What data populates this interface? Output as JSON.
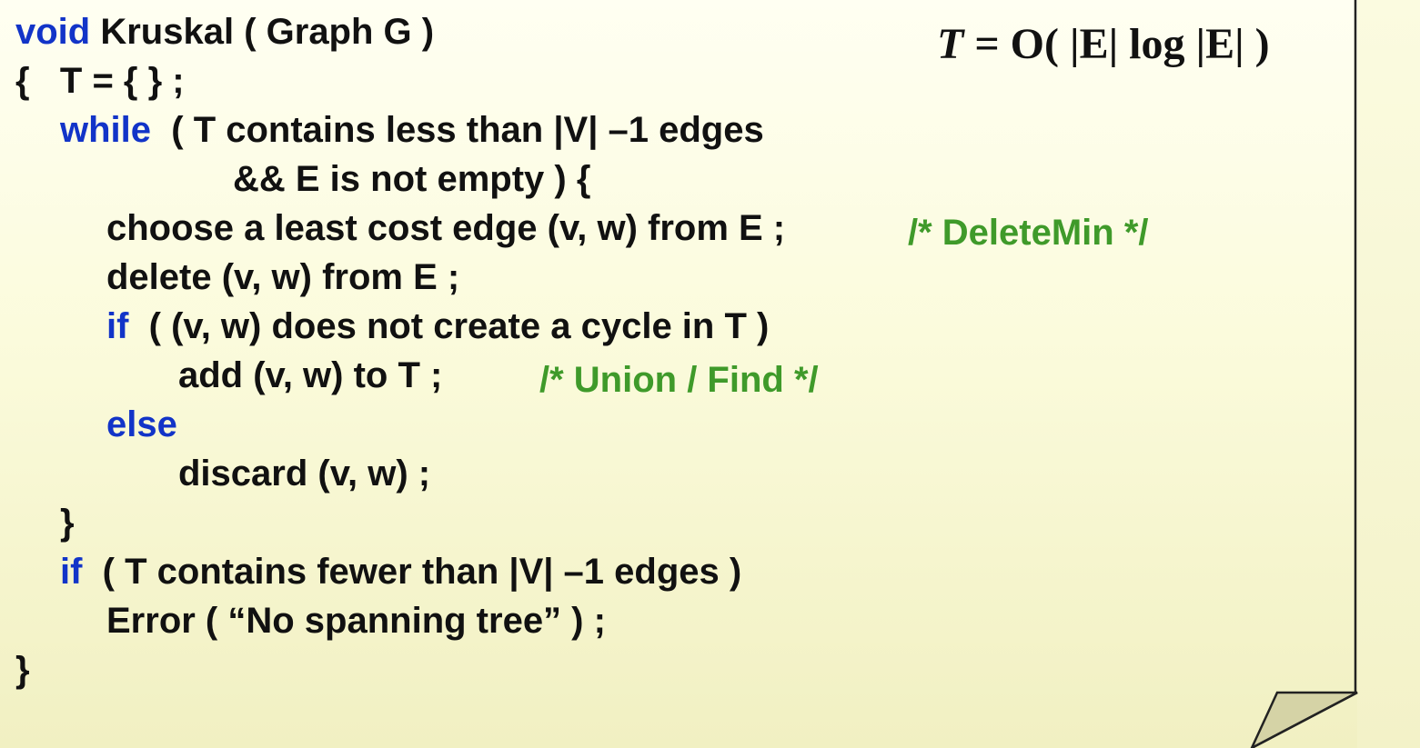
{
  "code": {
    "l1_kw": "void",
    "l1_text": " Kruskal ( Graph G )",
    "l2_text": "{   T = { } ;",
    "l3_kw": "while",
    "l3_text": "  ( T contains less than |V| –1 edges",
    "l4_text": "&& E is not empty ) {",
    "l5_text": "choose a least cost edge (v, w) from E ;",
    "l5_comment": "/* DeleteMin */",
    "l6_text": "delete (v, w) from E ;",
    "l7_kw": "if",
    "l7_text": "  ( (v, w) does not create a cycle in T )",
    "l8_text": "add (v, w) to T ;",
    "l8_comment": "/* Union / Find */",
    "l9_kw": "else",
    "l10_text": "discard (v, w) ;",
    "l11_text": "}",
    "l12_kw": "if",
    "l12_text": "  ( T contains fewer than |V| –1 edges )",
    "l13_text": "Error ( “No spanning tree” ) ;",
    "l14_text": "}"
  },
  "complexity": {
    "var": "T",
    "expr": " = O( |E| log |E| )"
  },
  "colors": {
    "keyword": "#1234c8",
    "comment": "#3f9a2a",
    "text": "#111111",
    "background": "#fbfbdc"
  }
}
